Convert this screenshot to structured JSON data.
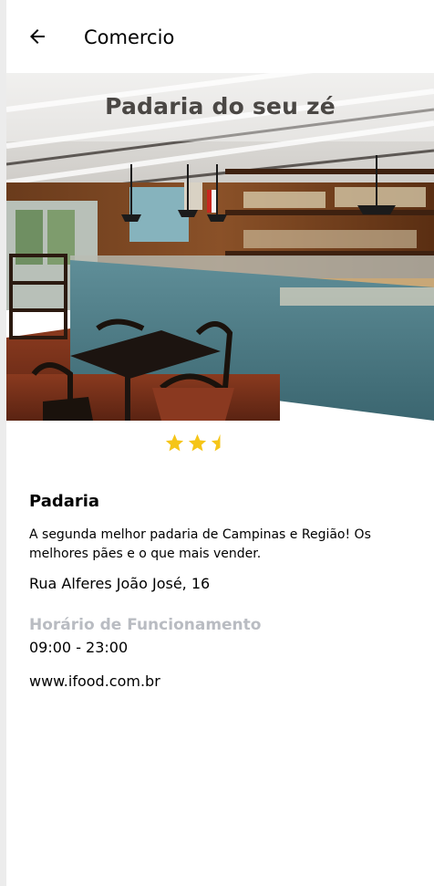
{
  "header": {
    "back_icon": "arrow-left-icon",
    "title": "Comercio"
  },
  "hero": {
    "title": "Padaria do seu zé",
    "image": "bakery-interior-photo"
  },
  "rating": {
    "value": 2.5,
    "max": 5,
    "visible_stars": 3,
    "color": "#f5c518"
  },
  "details": {
    "category": "Padaria",
    "description": "A segunda melhor padaria de Campinas e Região! Os melhores pães e o que mais vender.",
    "address": "Rua Alferes João José, 16",
    "hours_label": "Horário de Funcionamento",
    "hours_value": "09:00 - 23:00",
    "website": "www.ifood.com.br"
  },
  "colors": {
    "hours_label": "#b9bcc2",
    "star": "#f5c518"
  }
}
